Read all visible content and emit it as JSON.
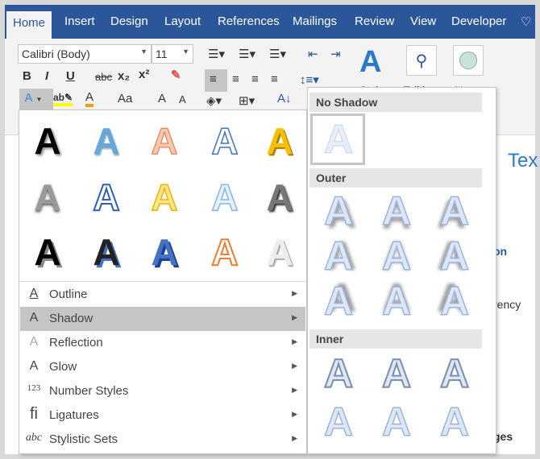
{
  "tabs": [
    "Home",
    "Insert",
    "Design",
    "Layout",
    "References",
    "Mailings",
    "Review",
    "View",
    "Developer"
  ],
  "font": {
    "name": "Calibri (Body)",
    "size": "11"
  },
  "format_buttons": {
    "bold": "B",
    "italic": "I",
    "underline": "U",
    "strike": "abc",
    "subscript": "x₂",
    "superscript": "x²",
    "change_case": "Aa",
    "grow": "A",
    "shrink": "A",
    "sort": "A↓"
  },
  "groups": {
    "styles": "Styles",
    "editing": "Editing",
    "new": "New"
  },
  "shadow_menu": {
    "no_shadow": "No Shadow",
    "outer": "Outer",
    "inner": "Inner",
    "glyph": "A"
  },
  "text_effects_glyph": "A",
  "menu_items": [
    {
      "icon": "A",
      "label": "Outline"
    },
    {
      "icon": "A",
      "label": "Shadow",
      "selected": true
    },
    {
      "icon": "A",
      "label": "Reflection"
    },
    {
      "icon": "A",
      "label": "Glow"
    },
    {
      "icon": "123",
      "label": "Number Styles"
    },
    {
      "icon": "fi",
      "label": "Ligatures"
    },
    {
      "icon": "abc",
      "label": "Stylistic Sets"
    }
  ],
  "doc_fragments": {
    "t1": "Tex",
    "t2": "on",
    "t3": "rency",
    "t4": "ges"
  }
}
